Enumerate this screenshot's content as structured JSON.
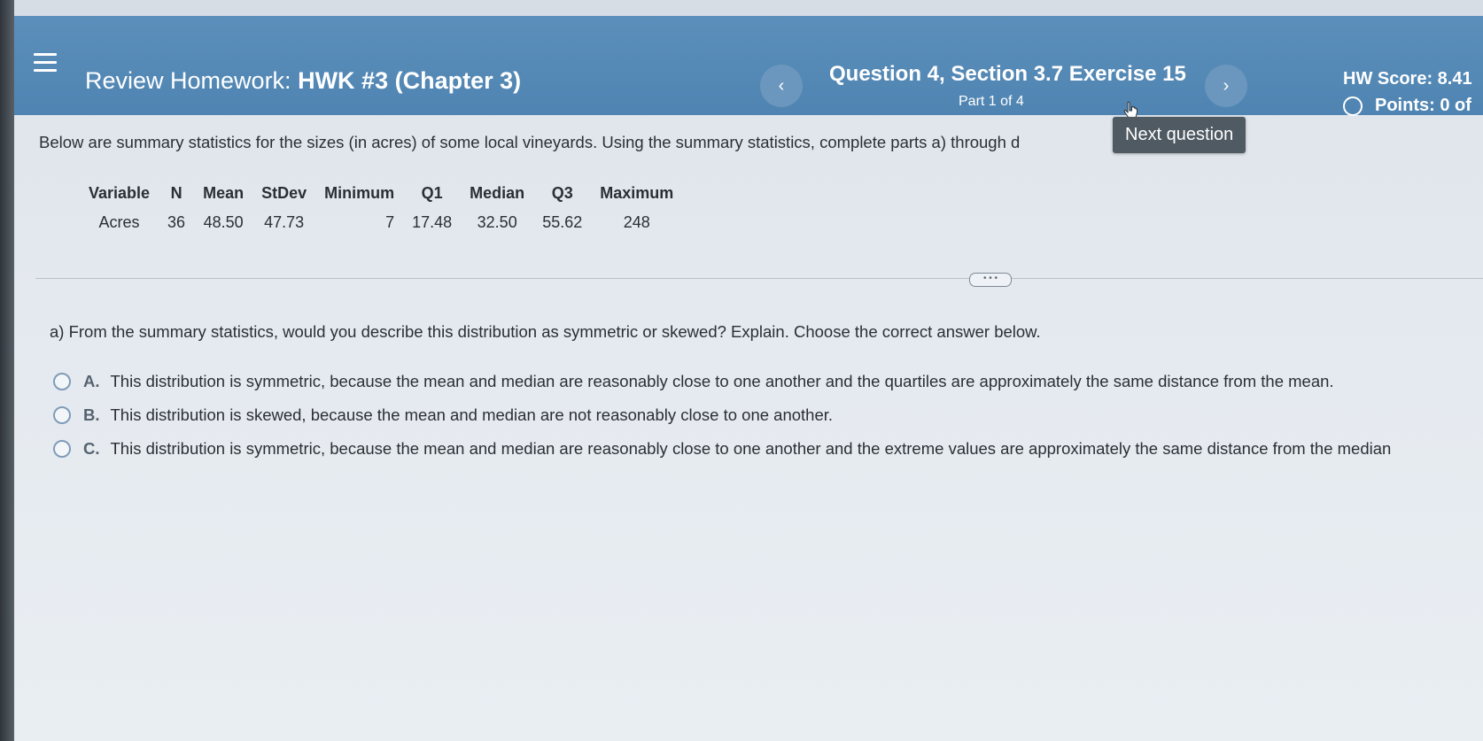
{
  "header": {
    "title_prefix": "Review Homework:",
    "title_name": "HWK #3 (Chapter 3)",
    "question_title": "Question 4, Section 3.7 Exercise 15",
    "part": "Part 1 of 4",
    "prev_label": "‹",
    "next_label": "›",
    "hw_score": "HW Score: 8.41",
    "points": "Points: 0 of",
    "tooltip": "Next question"
  },
  "content": {
    "intro": "Below are summary statistics for the sizes (in acres) of some local vineyards. Using the summary statistics, complete parts a) through d",
    "table": {
      "headers": [
        "Variable",
        "N",
        "Mean",
        "StDev",
        "Minimum",
        "Q1",
        "Median",
        "Q3",
        "Maximum"
      ],
      "row": [
        "Acres",
        "36",
        "48.50",
        "47.73",
        "7",
        "17.48",
        "32.50",
        "55.62",
        "248"
      ]
    },
    "expand_label": "• • •",
    "question": "a) From the summary statistics, would you describe this distribution as symmetric or skewed? Explain. Choose the correct answer below.",
    "options": [
      {
        "letter": "A.",
        "text": "This distribution is symmetric, because the mean and median are reasonably close to one another and the quartiles are approximately the same distance from the mean."
      },
      {
        "letter": "B.",
        "text": "This distribution is skewed, because the mean and median are not reasonably close to one another."
      },
      {
        "letter": "C.",
        "text": "This distribution is symmetric, because the mean and median are reasonably close to one another and the extreme values are approximately the same distance from the median"
      }
    ]
  },
  "colors": {
    "header_bg": "#5a8db8",
    "tooltip_bg": "#4f5a63",
    "page_bg": "#e4e9ef"
  }
}
